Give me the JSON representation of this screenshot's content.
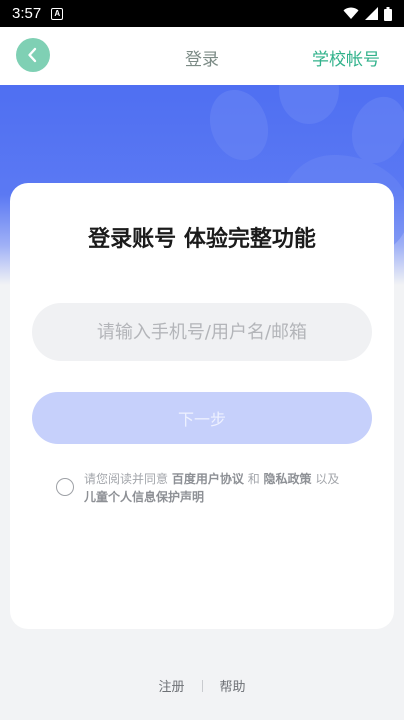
{
  "status_bar": {
    "time": "3:57",
    "notification_glyph": "A"
  },
  "header": {
    "title": "登录",
    "right_link": "学校帐号"
  },
  "card": {
    "title": "登录账号 体验完整功能",
    "account_input_placeholder": "请输入手机号/用户名/邮箱",
    "next_button": "下一步"
  },
  "agreement": {
    "prefix": "请您阅读并同意",
    "link_user_agreement": "百度用户协议",
    "and": "和",
    "link_privacy": "隐私政策",
    "also": "以及",
    "link_children": "儿童个人信息保护声明"
  },
  "footer": {
    "register": "注册",
    "help": "帮助"
  },
  "colors": {
    "accent": "#31b28b",
    "hero_blue": "#5173f2",
    "button_disabled": "#c6d0fb"
  }
}
